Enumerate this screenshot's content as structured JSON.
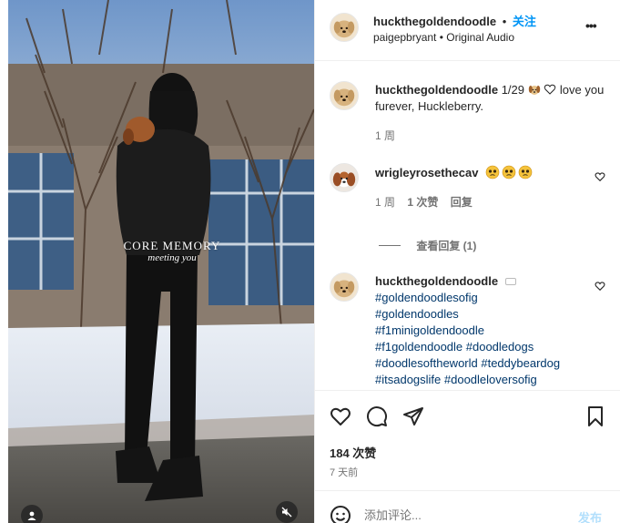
{
  "header": {
    "username": "huckthegoldendoodle",
    "separator": "•",
    "follow_label": "关注",
    "subtitle_user": "paigepbryant",
    "subtitle_sep": "•",
    "subtitle_audio": "Original Audio",
    "more_label": "•••"
  },
  "media": {
    "overlay_line1": "CORE MEMORY",
    "overlay_line2": "meeting you"
  },
  "caption": {
    "username": "huckthegoldendoodle",
    "text_a": "1/29",
    "text_b": "love you furever, Huckleberry.",
    "time": "1 周"
  },
  "comment1": {
    "username": "wrigleyrosethecav",
    "text": "🥺🥺🥺",
    "time": "1 周",
    "likes": "1 次赞",
    "reply": "回复",
    "view_replies": "查看回复 (1)"
  },
  "comment2": {
    "username": "huckthegoldendoodle",
    "hashtags": [
      "#goldendoodlesofig",
      "#goldendoodles",
      "#f1minigoldendoodle",
      "#f1goldendoodle #doodledogs",
      "#doodlesoftheworld #teddybeardog",
      "#itsadogslife #doodleloversofig"
    ]
  },
  "actions": {
    "likes_count": "184 次赞",
    "posted": "7 天前"
  },
  "comment_box": {
    "placeholder": "添加评论...",
    "post_label": "发布"
  },
  "colors": {
    "accent": "#0095f6",
    "hashtag": "#00376b",
    "muted": "#737373"
  }
}
